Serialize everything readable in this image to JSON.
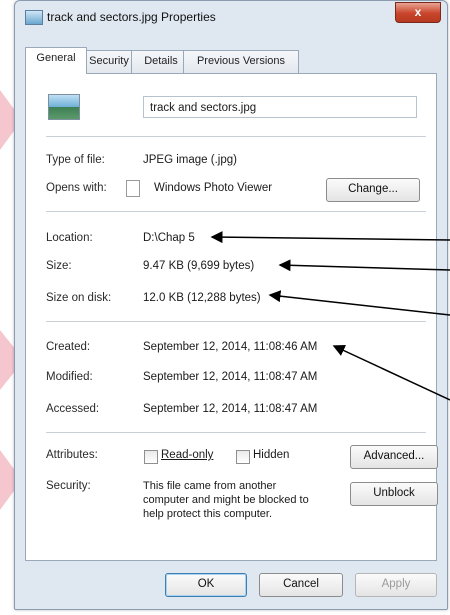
{
  "window": {
    "title": "track and sectors.jpg Properties",
    "close_glyph": "x"
  },
  "tabs": [
    {
      "label": "General",
      "active": true
    },
    {
      "label": "Security"
    },
    {
      "label": "Details"
    },
    {
      "label": "Previous Versions"
    }
  ],
  "general": {
    "file_name": "track and sectors.jpg",
    "type_label": "Type of file:",
    "type_value": "JPEG image (.jpg)",
    "opens_label": "Opens with:",
    "opens_value": "Windows Photo Viewer",
    "change_button": "Change...",
    "location_label": "Location:",
    "location_value": "D:\\Chap 5",
    "size_label": "Size:",
    "size_value": "9.47 KB (9,699 bytes)",
    "size_on_disk_label": "Size on disk:",
    "size_on_disk_value": "12.0 KB (12,288 bytes)",
    "created_label": "Created:",
    "created_value": "September 12, 2014, 11:08:46 AM",
    "modified_label": "Modified:",
    "modified_value": "September 12, 2014, 11:08:47 AM",
    "accessed_label": "Accessed:",
    "accessed_value": "September 12, 2014, 11:08:47 AM",
    "attributes_label": "Attributes:",
    "readonly_label": "Read-only",
    "readonly_checked": false,
    "hidden_label": "Hidden",
    "hidden_checked": false,
    "advanced_button": "Advanced...",
    "security_label": "Security:",
    "security_text_1": "This file came from another",
    "security_text_2": "computer and might be blocked to",
    "security_text_3": "help protect this computer.",
    "unblock_button": "Unblock"
  },
  "footer": {
    "ok": "OK",
    "cancel": "Cancel",
    "apply": "Apply"
  },
  "colors": {
    "arrow": "#000000",
    "accent_pink": "#f6c6cf",
    "close": "#c9442a"
  }
}
